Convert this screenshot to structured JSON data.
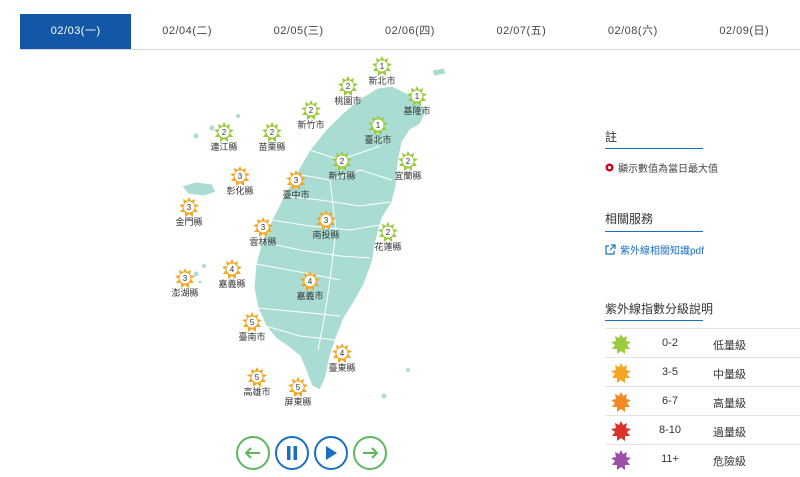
{
  "tabs": [
    {
      "label": "02/03(一)",
      "active": true
    },
    {
      "label": "02/04(二)",
      "active": false
    },
    {
      "label": "02/05(三)",
      "active": false
    },
    {
      "label": "02/06(四)",
      "active": false
    },
    {
      "label": "02/07(五)",
      "active": false
    },
    {
      "label": "02/08(六)",
      "active": false
    },
    {
      "label": "02/09(日)",
      "active": false
    }
  ],
  "colors": {
    "low": "#9bcb3c",
    "moderate": "#f5a623",
    "high": "#f08a24",
    "very_high": "#d9332b",
    "extreme": "#9b4fa8",
    "land": "#a9ddd3",
    "accent": "#1257a8"
  },
  "stations": [
    {
      "name": "新北市",
      "value": "1"
    },
    {
      "name": "桃園市",
      "value": "2"
    },
    {
      "name": "基隆市",
      "value": "1"
    },
    {
      "name": "新竹市",
      "value": "2"
    },
    {
      "name": "臺北市",
      "value": "1"
    },
    {
      "name": "連江縣",
      "value": "2"
    },
    {
      "name": "苗栗縣",
      "value": "2"
    },
    {
      "name": "新竹縣",
      "value": "2"
    },
    {
      "name": "宜蘭縣",
      "value": "2"
    },
    {
      "name": "彰化縣",
      "value": "3"
    },
    {
      "name": "臺中市",
      "value": "3"
    },
    {
      "name": "金門縣",
      "value": "3"
    },
    {
      "name": "南投縣",
      "value": "3"
    },
    {
      "name": "雲林縣",
      "value": "3"
    },
    {
      "name": "花蓮縣",
      "value": "2"
    },
    {
      "name": "澎湖縣",
      "value": "3"
    },
    {
      "name": "嘉義縣",
      "value": "4"
    },
    {
      "name": "嘉義市",
      "value": "4"
    },
    {
      "name": "臺南市",
      "value": "5"
    },
    {
      "name": "臺東縣",
      "value": "4"
    },
    {
      "name": "高雄市",
      "value": "5"
    },
    {
      "name": "屏東縣",
      "value": "5"
    }
  ],
  "sidebar": {
    "note_title": "註",
    "note_text": "顯示數值為當日最大值",
    "related_title": "相關服務",
    "related_link": "紫外線相關知識pdf",
    "legend_title": "紫外線指數分級說明",
    "legend": [
      {
        "range": "0-2",
        "level": "低量級",
        "color": "#9bcb3c"
      },
      {
        "range": "3-5",
        "level": "中量級",
        "color": "#f5a623"
      },
      {
        "range": "6-7",
        "level": "高量級",
        "color": "#f08a24"
      },
      {
        "range": "8-10",
        "level": "過量級",
        "color": "#d9332b"
      },
      {
        "range": "11+",
        "level": "危險級",
        "color": "#9b4fa8"
      }
    ]
  },
  "controls": [
    "previous-day",
    "pause",
    "play",
    "next-day"
  ]
}
